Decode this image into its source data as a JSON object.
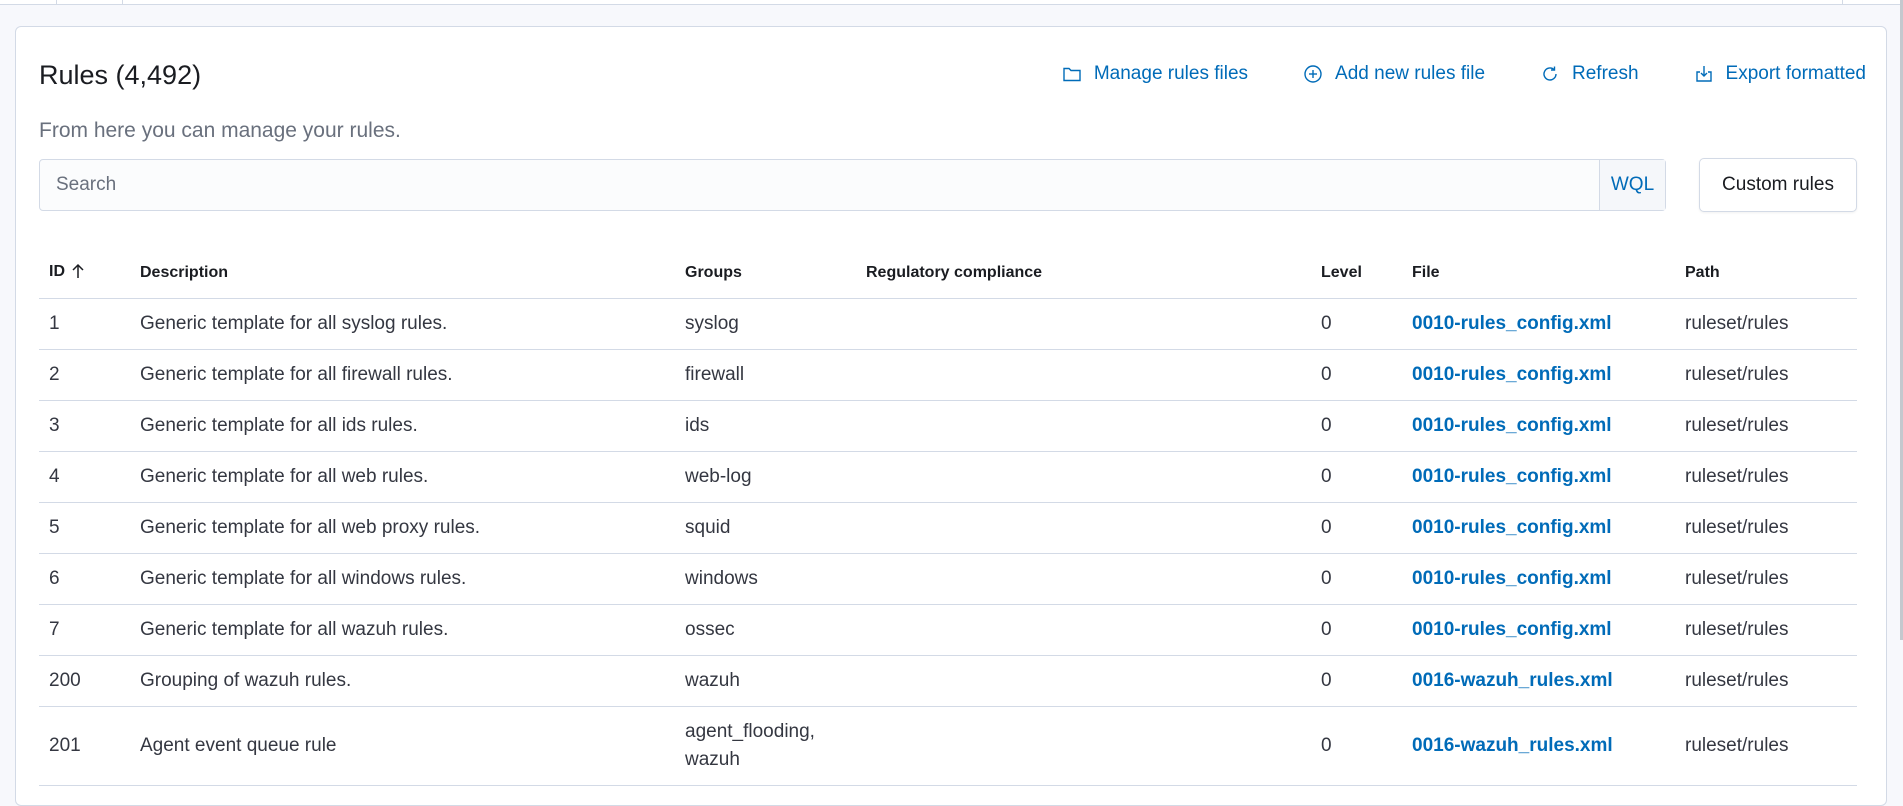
{
  "header": {
    "title": "Rules (4,492)",
    "subtitle": "From here you can manage your rules."
  },
  "actions": [
    {
      "label": "Manage rules files",
      "icon": "folder-icon"
    },
    {
      "label": "Add new rules file",
      "icon": "plus-circle-icon"
    },
    {
      "label": "Refresh",
      "icon": "refresh-icon"
    },
    {
      "label": "Export formatted",
      "icon": "export-icon"
    }
  ],
  "search": {
    "placeholder": "Search",
    "wql_label": "WQL"
  },
  "custom_rules_label": "Custom rules",
  "table": {
    "columns": [
      "ID",
      "Description",
      "Groups",
      "Regulatory compliance",
      "Level",
      "File",
      "Path"
    ],
    "rows": [
      {
        "id": "1",
        "description": "Generic template for all syslog rules.",
        "groups": "syslog",
        "compliance": "",
        "level": "0",
        "file": "0010-rules_config.xml",
        "path": "ruleset/rules"
      },
      {
        "id": "2",
        "description": "Generic template for all firewall rules.",
        "groups": "firewall",
        "compliance": "",
        "level": "0",
        "file": "0010-rules_config.xml",
        "path": "ruleset/rules"
      },
      {
        "id": "3",
        "description": "Generic template for all ids rules.",
        "groups": "ids",
        "compliance": "",
        "level": "0",
        "file": "0010-rules_config.xml",
        "path": "ruleset/rules"
      },
      {
        "id": "4",
        "description": "Generic template for all web rules.",
        "groups": "web-log",
        "compliance": "",
        "level": "0",
        "file": "0010-rules_config.xml",
        "path": "ruleset/rules"
      },
      {
        "id": "5",
        "description": "Generic template for all web proxy rules.",
        "groups": "squid",
        "compliance": "",
        "level": "0",
        "file": "0010-rules_config.xml",
        "path": "ruleset/rules"
      },
      {
        "id": "6",
        "description": "Generic template for all windows rules.",
        "groups": "windows",
        "compliance": "",
        "level": "0",
        "file": "0010-rules_config.xml",
        "path": "ruleset/rules"
      },
      {
        "id": "7",
        "description": "Generic template for all wazuh rules.",
        "groups": "ossec",
        "compliance": "",
        "level": "0",
        "file": "0010-rules_config.xml",
        "path": "ruleset/rules"
      },
      {
        "id": "200",
        "description": "Grouping of wazuh rules.",
        "groups": "wazuh",
        "compliance": "",
        "level": "0",
        "file": "0016-wazuh_rules.xml",
        "path": "ruleset/rules"
      },
      {
        "id": "201",
        "description": "Agent event queue rule",
        "groups": "agent_flooding, wazuh",
        "compliance": "",
        "level": "0",
        "file": "0016-wazuh_rules.xml",
        "path": "ruleset/rules"
      }
    ]
  },
  "colors": {
    "link": "#006bb8",
    "border": "#d3dae6",
    "text": "#343741"
  }
}
